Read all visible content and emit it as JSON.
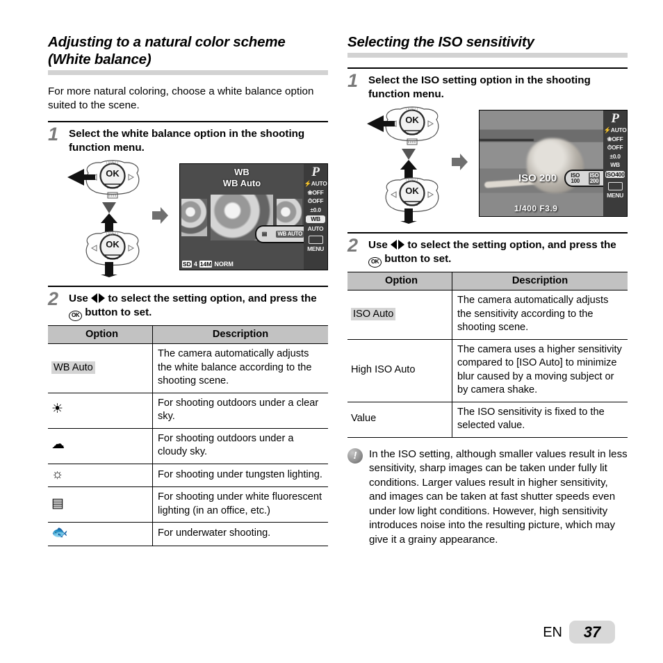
{
  "left": {
    "heading": "Adjusting to a natural color scheme (White balance)",
    "intro": "For more natural coloring, choose a white balance option suited to the scene.",
    "step1": {
      "num": "1",
      "text": "Select the white balance option in the shooting function menu."
    },
    "step2": {
      "num": "2",
      "text_a": "Use ",
      "text_b": " to select the setting option, and press the ",
      "text_c": " button to set."
    },
    "lcd": {
      "title_line1": "WB",
      "title_line2": "WB Auto",
      "mode": "P",
      "side_icons": [
        "flash-auto",
        "macro-off",
        "timer-off",
        "exposure-0.0",
        "white-balance",
        "iso-auto",
        "drive-single",
        "menu"
      ],
      "side_labels": [
        "AUTO",
        "OFF",
        "OFF",
        "0.0",
        "WB",
        "AUTO",
        "",
        "MENU"
      ],
      "selected_side_index": 4,
      "pill_options": [
        "fluorescent-icon",
        "WB AUTO",
        "sun-icon"
      ],
      "pill_selected": "WB AUTO",
      "bottom_info": {
        "card": "SD",
        "shots": "4",
        "size": "14M",
        "quality": "NORM"
      }
    },
    "table": {
      "headers": [
        "Option",
        "Description"
      ],
      "rows": [
        {
          "option": "WB Auto",
          "option_kind": "text",
          "highlight": true,
          "description": "The camera automatically adjusts the white balance according to the shooting scene."
        },
        {
          "option": "☀",
          "option_kind": "icon",
          "icon_name": "sun-icon",
          "highlight": false,
          "description": "For shooting outdoors under a clear sky."
        },
        {
          "option": "☁",
          "option_kind": "icon",
          "icon_name": "cloud-icon",
          "highlight": false,
          "description": "For shooting outdoors under a cloudy sky."
        },
        {
          "option": "☼",
          "option_kind": "icon",
          "icon_name": "tungsten-lamp-icon",
          "highlight": false,
          "description": "For shooting under tungsten lighting."
        },
        {
          "option": "▤",
          "option_kind": "icon",
          "icon_name": "fluorescent-tube-icon",
          "highlight": false,
          "description": "For shooting under white fluorescent lighting (in an office, etc.)"
        },
        {
          "option": "🐟",
          "option_kind": "icon",
          "icon_name": "fish-underwater-icon",
          "highlight": false,
          "description": "For underwater shooting."
        }
      ]
    }
  },
  "right": {
    "heading": "Selecting the ISO sensitivity",
    "step1": {
      "num": "1",
      "text": "Select the ISO setting option in the shooting function menu."
    },
    "step2": {
      "num": "2",
      "text_a": "Use ",
      "text_b": " to select the setting option, and press the ",
      "text_c": " button to set."
    },
    "lcd": {
      "mode": "P",
      "iso_value": "ISO 200",
      "exposure": "1/400   F3.9",
      "side_labels": [
        "AUTO",
        "OFF",
        "OFF",
        "0.0",
        "WB",
        "400",
        "",
        "MENU"
      ],
      "selected_side_index": 5,
      "pill_options": [
        "ISO 100",
        "ISO 200",
        "ISO 400"
      ],
      "pill_option_lines": [
        [
          "ISO",
          "100"
        ],
        [
          "ISO",
          "200"
        ],
        [
          "ISO",
          "400"
        ]
      ],
      "pill_selected": "ISO 200"
    },
    "table": {
      "headers": [
        "Option",
        "Description"
      ],
      "rows": [
        {
          "option": "ISO Auto",
          "highlight": true,
          "description": "The camera automatically adjusts the sensitivity according to the shooting scene."
        },
        {
          "option": "High ISO Auto",
          "highlight": false,
          "description": "The camera uses a higher sensitivity compared to [ISO Auto] to minimize blur caused by a moving subject or by camera shake."
        },
        {
          "option": "Value",
          "highlight": false,
          "description": "The ISO sensitivity is fixed to the selected value."
        }
      ]
    },
    "note": {
      "icon": "exclamation-icon",
      "text": "In the ISO setting, although smaller values result in less sensitivity, sharp images can be taken under fully lit conditions. Larger values result in higher sensitivity, and images can be taken at fast shutter speeds even under low light conditions. However, high sensitivity introduces noise into the resulting picture, which may give it a grainy appearance."
    }
  },
  "footer": {
    "language": "EN",
    "page": "37"
  },
  "dpad": {
    "info_label": "INFO",
    "ok_label": "OK",
    "trash_label": "trash-icon"
  },
  "colors": {
    "heading_rule": "#d2d2d2",
    "table_header_bg": "#c2c2c2",
    "highlight_bg": "#d4d4d4",
    "page_badge_bg": "#d8d8d8"
  }
}
